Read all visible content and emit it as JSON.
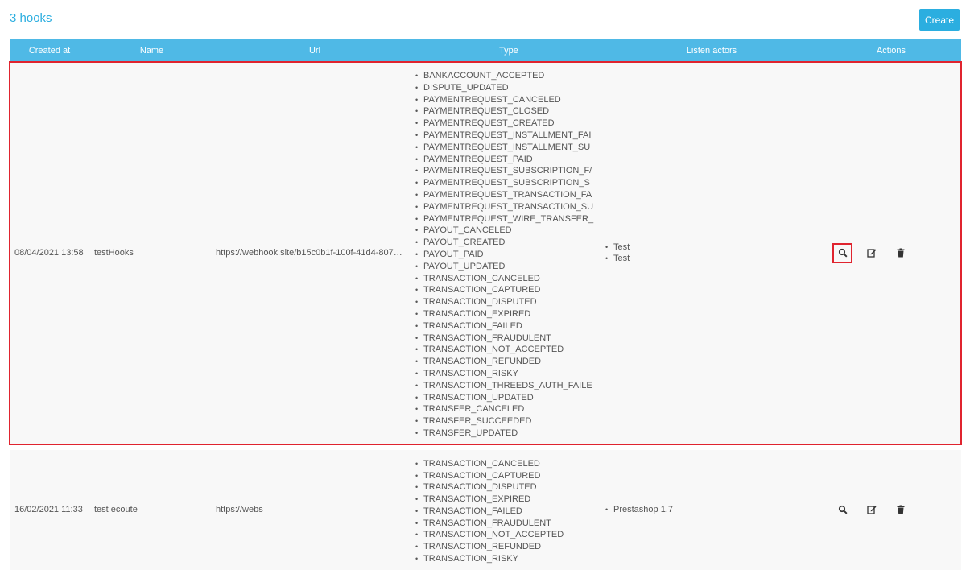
{
  "header": {
    "title": "3 hooks",
    "create_label": "Create"
  },
  "table": {
    "columns": [
      "Created at",
      "Name",
      "Url",
      "Type",
      "Listen actors",
      "Actions"
    ],
    "rows": [
      {
        "created_at": "08/04/2021 13:58",
        "name": "testHooks",
        "url": "https://webhook.site/b15c0b1f-100f-41d4-807…",
        "types": [
          "BANKACCOUNT_ACCEPTED",
          "DISPUTE_UPDATED",
          "PAYMENTREQUEST_CANCELED",
          "PAYMENTREQUEST_CLOSED",
          "PAYMENTREQUEST_CREATED",
          "PAYMENTREQUEST_INSTALLMENT_FAI",
          "PAYMENTREQUEST_INSTALLMENT_SU",
          "PAYMENTREQUEST_PAID",
          "PAYMENTREQUEST_SUBSCRIPTION_F/",
          "PAYMENTREQUEST_SUBSCRIPTION_S",
          "PAYMENTREQUEST_TRANSACTION_FA",
          "PAYMENTREQUEST_TRANSACTION_SU",
          "PAYMENTREQUEST_WIRE_TRANSFER_",
          "PAYOUT_CANCELED",
          "PAYOUT_CREATED",
          "PAYOUT_PAID",
          "PAYOUT_UPDATED",
          "TRANSACTION_CANCELED",
          "TRANSACTION_CAPTURED",
          "TRANSACTION_DISPUTED",
          "TRANSACTION_EXPIRED",
          "TRANSACTION_FAILED",
          "TRANSACTION_FRAUDULENT",
          "TRANSACTION_NOT_ACCEPTED",
          "TRANSACTION_REFUNDED",
          "TRANSACTION_RISKY",
          "TRANSACTION_THREEDS_AUTH_FAILE",
          "TRANSACTION_UPDATED",
          "TRANSFER_CANCELED",
          "TRANSFER_SUCCEEDED",
          "TRANSFER_UPDATED"
        ],
        "actors": [
          "Test",
          "Test"
        ]
      },
      {
        "created_at": "16/02/2021 11:33",
        "name": "test ecoute",
        "url": "https://webs",
        "types": [
          "TRANSACTION_CANCELED",
          "TRANSACTION_CAPTURED",
          "TRANSACTION_DISPUTED",
          "TRANSACTION_EXPIRED",
          "TRANSACTION_FAILED",
          "TRANSACTION_FRAUDULENT",
          "TRANSACTION_NOT_ACCEPTED",
          "TRANSACTION_REFUNDED",
          "TRANSACTION_RISKY"
        ],
        "actors": [
          "Prestashop 1.7"
        ]
      }
    ]
  },
  "icons": {
    "view": "search-icon",
    "edit": "edit-icon",
    "delete": "trash-icon"
  },
  "colors": {
    "accent": "#2baee0",
    "header_bg": "#4fb9e6",
    "highlight": "#e0242f"
  }
}
